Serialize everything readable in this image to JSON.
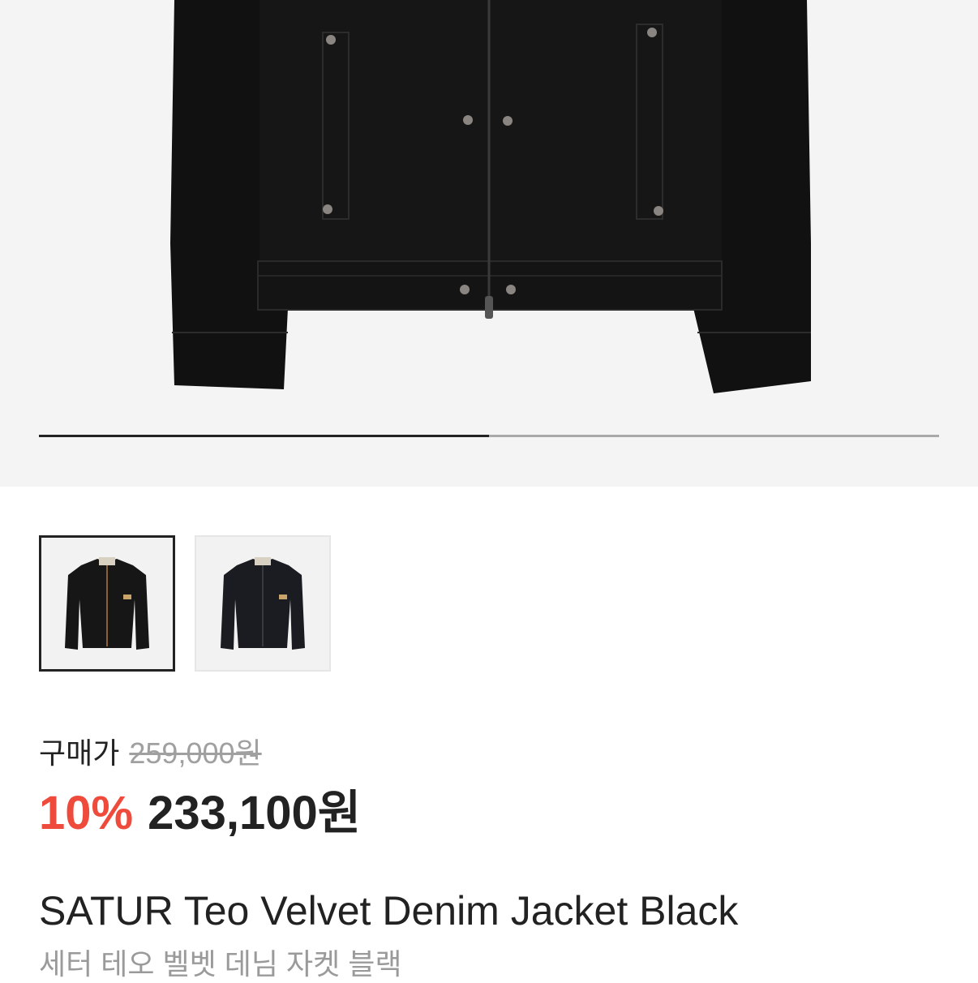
{
  "gallery": {
    "image_alt": "SATUR Teo Velvet Denim Jacket Black",
    "progress_fraction": 0.5,
    "thumbnails": [
      {
        "label": "thumbnail-1",
        "active": true
      },
      {
        "label": "thumbnail-2",
        "active": false
      }
    ]
  },
  "price": {
    "label": "구매가",
    "original": "259,000원",
    "discount": "10%",
    "final": "233,100원"
  },
  "product": {
    "name": "SATUR Teo Velvet Denim Jacket Black",
    "name_kr": "세터 테오 벨벳 데님 자켓 블랙"
  },
  "colors": {
    "discount": "#ef4b3c",
    "hero_bg": "#f4f4f4",
    "jacket": "#151515"
  }
}
